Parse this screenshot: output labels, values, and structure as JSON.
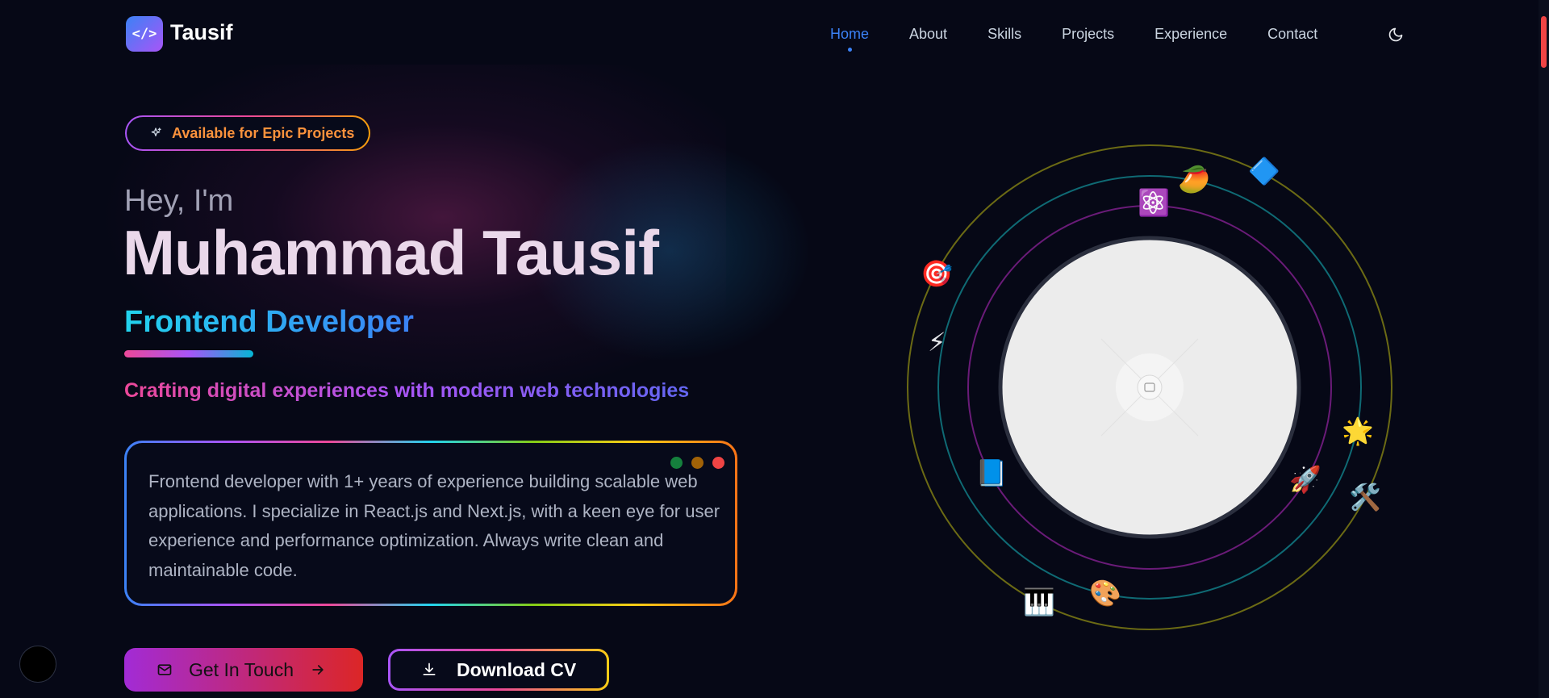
{
  "nav": {
    "logo_icon": "</>",
    "logo_text": "Tausif",
    "items": [
      {
        "label": "Home",
        "active": true
      },
      {
        "label": "About"
      },
      {
        "label": "Skills"
      },
      {
        "label": "Projects"
      },
      {
        "label": "Experience"
      },
      {
        "label": "Contact"
      }
    ],
    "theme_icon": "moon-icon"
  },
  "hero": {
    "badge": "Available for Epic Projects",
    "greeting": "Hey, I'm",
    "name": "Muhammad Tausif",
    "role": "Frontend Developer",
    "tagline": "Crafting digital experiences with modern web technologies",
    "bio": "Frontend developer with 1+ years of experience building scalable web applications. I specialize in React.js and Next.js, with a keen eye for user experience and performance optimization. Always write clean and maintainable code.",
    "buttons": {
      "contact": "Get In Touch",
      "download": "Download CV"
    }
  },
  "orbit": {
    "icons": [
      "⚛️",
      "🥭",
      "🔷",
      "🎯",
      "⚡",
      "📘",
      "🚀",
      "🌟",
      "🛠️",
      "🎨",
      "🎹"
    ]
  },
  "colors": {
    "background": "#060816",
    "accent_blue": "#3b82f6",
    "accent_purple": "#a855f7",
    "accent_pink": "#ec4899",
    "accent_orange": "#fb923c",
    "accent_cyan": "#22d3ee"
  }
}
